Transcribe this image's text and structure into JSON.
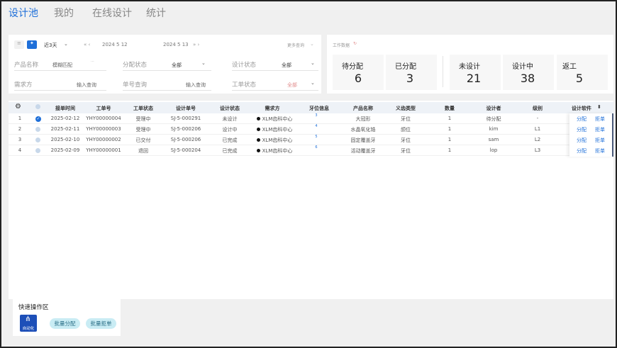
{
  "nav": {
    "tabs": [
      "设计池",
      "我的",
      "在线设计",
      "统计"
    ],
    "active_index": 0
  },
  "filters": {
    "range_label": "近3天",
    "date_start": "2024   5  12",
    "date_end": "2024   5  13",
    "more_query": "更多查询",
    "product_label": "产品名称",
    "product_value": "模糊匹配",
    "assign_status_label": "分配状态",
    "assign_status_value": "全部",
    "design_status_label": "设计状态",
    "design_status_value": "全部",
    "demander_label": "需求方",
    "demander_value": "输入查询",
    "order_query_label": "单号查询",
    "order_query_value": "输入查询",
    "order_status_label": "工单状态",
    "order_status_value": "全部"
  },
  "stats": {
    "title": "工作数据",
    "items": [
      {
        "label": "待分配",
        "value": "6"
      },
      {
        "label": "已分配",
        "value": "3"
      },
      {
        "label": "未设计",
        "value": "21"
      },
      {
        "label": "设计中",
        "value": "38"
      },
      {
        "label": "返工",
        "value": "5"
      }
    ]
  },
  "table": {
    "columns": [
      "接单时间",
      "工单号",
      "工单状态",
      "设计单号",
      "设计状态",
      "需求方",
      "牙位信息",
      "产品名称",
      "义齿类型",
      "数量",
      "设计者",
      "级别",
      "设计软件"
    ],
    "rows": [
      {
        "idx": "1",
        "checked": true,
        "time": "2025-02-12",
        "order": "YHY00000004",
        "order_status": "受理中",
        "design_no": "SJ-5-000291",
        "design_status": "未设计",
        "demander": "XLM齿科中心",
        "tooth": "3",
        "product": "大冠形",
        "type": "牙位",
        "qty": "1",
        "designer": "待分配",
        "level": "-"
      },
      {
        "idx": "2",
        "checked": false,
        "time": "2025-02-11",
        "order": "YHY00000003",
        "order_status": "受理中",
        "design_no": "SJ-5-000206",
        "design_status": "设计中",
        "demander": "XLM齿科中心",
        "tooth": "4",
        "product": "水晶氧化锆",
        "type": "颌位",
        "qty": "1",
        "designer": "kim",
        "level": "L1"
      },
      {
        "idx": "3",
        "checked": false,
        "time": "2025-02-10",
        "order": "YHY00000002",
        "order_status": "已交付",
        "design_no": "SJ-5-000206",
        "design_status": "已完成",
        "demander": "XLM齿科中心",
        "tooth": "5",
        "product": "固定覆盖牙",
        "type": "牙位",
        "qty": "1",
        "designer": "sam",
        "level": "L2"
      },
      {
        "idx": "4",
        "checked": false,
        "time": "2025-02-09",
        "order": "YHY00000001",
        "order_status": "退回",
        "design_no": "SJ-5-000204",
        "design_status": "已完成",
        "demander": "XLM齿科中心",
        "tooth": "6",
        "product": "活动覆盖牙",
        "type": "牙位",
        "qty": "1",
        "designer": "lop",
        "level": "L3"
      }
    ],
    "action_assign": "分配",
    "action_reject": "拒单"
  },
  "quick": {
    "title": "快速操作区",
    "auto_label": "自动化",
    "batch_assign": "批量分配",
    "batch_reject": "批量拒单"
  },
  "colors": {
    "accent": "#1e6fd9",
    "pill_bg": "#c9ecf4",
    "header_bg": "#eef2f7"
  }
}
